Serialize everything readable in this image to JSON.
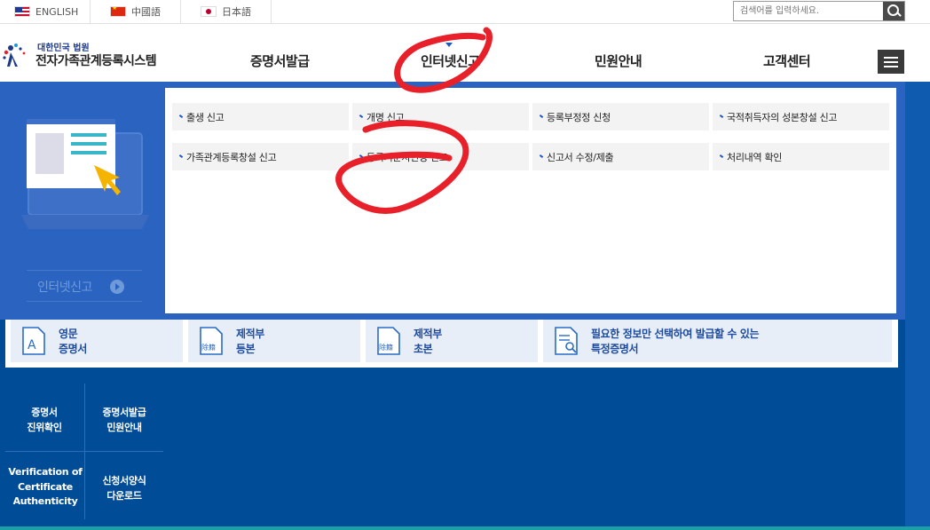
{
  "languages": [
    {
      "label": "ENGLISH",
      "flag": "us-flag-icon"
    },
    {
      "label": "中國語",
      "flag": "china-flag-icon"
    },
    {
      "label": "日本語",
      "flag": "japan-flag-icon"
    }
  ],
  "search": {
    "placeholder": "검색어를 입력하세요.",
    "button_icon": "search-icon"
  },
  "logo": {
    "court": "대한민국 법원",
    "system": "전자가족관계등록시스템"
  },
  "nav": {
    "items": [
      "증명서발급",
      "인터넷신고",
      "민원안내",
      "고객센터"
    ],
    "active": "인터넷신고",
    "menu_icon": "hamburger-menu-icon"
  },
  "dropdown": {
    "side_label": "인터넷신고",
    "items": [
      "출생 신고",
      "개명 신고",
      "등록부정정 신청",
      "국적취득자의 성본창설 신고",
      "가족관계등록창설 신고",
      "등록기준지변경 신고",
      "신고서 수정/제출",
      "처리내역 확인"
    ]
  },
  "certificates": [
    {
      "line1": "영문",
      "line2": "증명서",
      "icon": "english-certificate-icon"
    },
    {
      "line1": "제적부",
      "line2": "등본",
      "icon": "removed-register-icon"
    },
    {
      "line1": "제적부",
      "line2": "초본",
      "icon": "removed-register-icon"
    },
    {
      "line1": "필요한 정보만 선택하여 발급할 수 있는",
      "line2": "특정증명서",
      "icon": "document-search-icon"
    }
  ],
  "quick_links": [
    {
      "line1": "증명서",
      "line2": "진위확인"
    },
    {
      "line1": "증명서발급",
      "line2": "민원안내"
    },
    {
      "lines": [
        "Verification of",
        "Certificate",
        "Authenticity"
      ]
    },
    {
      "line1": "신청서양식",
      "line2": "다운로드"
    }
  ],
  "colors": {
    "primary_blue": "#004c97",
    "dropdown_blue": "#2b64c0",
    "annotation_red": "#e8202a"
  }
}
